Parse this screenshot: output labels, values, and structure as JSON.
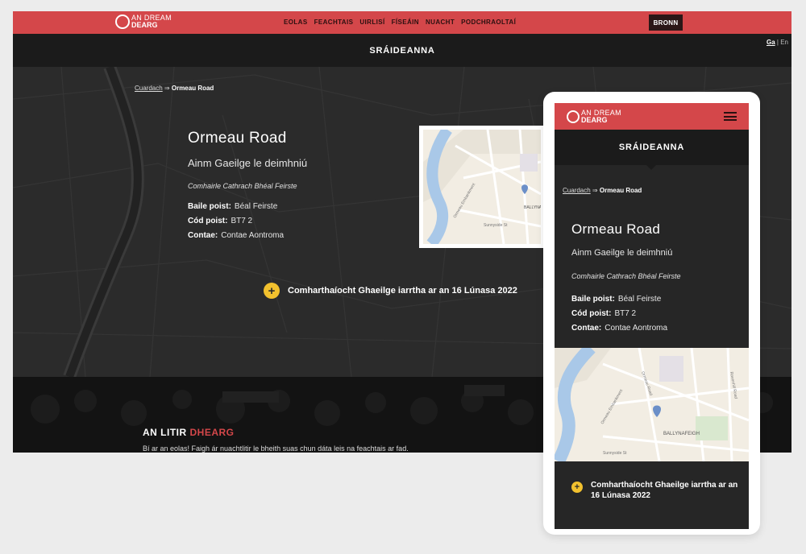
{
  "brand": {
    "line1": "AN DREAM",
    "line2": "DEARG"
  },
  "nav": {
    "items": [
      {
        "label": "EOLAS"
      },
      {
        "label": "FEACHTAIS"
      },
      {
        "label": "UIRLISÍ"
      },
      {
        "label": "FÍSEÁIN"
      },
      {
        "label": "NUACHT"
      },
      {
        "label": "PODCHRAOLTAÍ"
      }
    ],
    "give_label": "BRONN"
  },
  "lang": {
    "ga": "Ga",
    "sep": "|",
    "en": "En"
  },
  "page": {
    "section_title": "SRÁIDEANNA",
    "breadcrumb": {
      "link": "Cuardach",
      "arrow": "⇒",
      "current": "Ormeau Road"
    },
    "street_name": "Ormeau Road",
    "irish_name": "Ainm Gaeilge le deimhniú",
    "council": "Comhairle Cathrach Bhéal Feirste",
    "fields": [
      {
        "label": "Baile poist:",
        "value": "Béal Feirste"
      },
      {
        "label": "Cód poist:",
        "value": "BT7 2"
      },
      {
        "label": "Contae:",
        "value": "Contae Aontroma"
      }
    ],
    "cta": "Comharthaíocht Ghaeilge iarrtha ar an 16 Lúnasa 2022"
  },
  "map": {
    "labels": [
      "Ravenhill Road",
      "BALLYNAFEIGH",
      "Sunnyside St",
      "Ormeau Embankment",
      "Ormeau Road"
    ]
  },
  "newsletter": {
    "title_a": "AN LITIR ",
    "title_b": "DHEARG",
    "body": "Bí ar an eolas! Faigh ár nuachtlitir le bheith suas chun dáta leis na feachtais ar fad."
  },
  "colors": {
    "brand_red": "#d4474a",
    "dark": "#1b1b1b",
    "accent_yellow": "#f2c12e"
  }
}
